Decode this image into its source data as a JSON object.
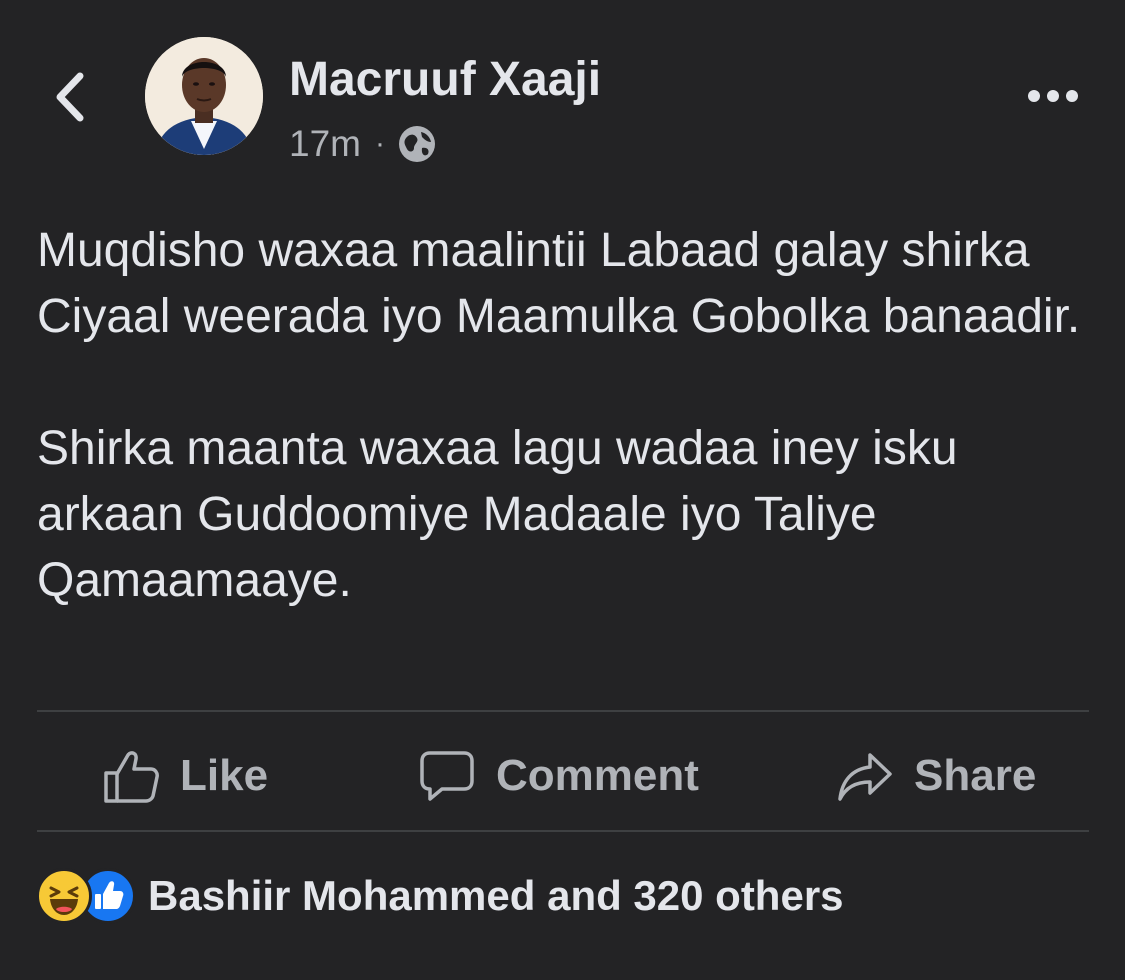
{
  "post": {
    "author": "Macruuf Xaaji",
    "time": "17m",
    "separator": "·",
    "privacy_icon": "globe-icon",
    "paragraphs": [
      "Muqdisho waxaa maalintii Labaad galay shirka Ciyaal weerada iyo Maamulka Gobolka banaadir.",
      "Shirka maanta waxaa lagu wadaa iney isku arkaan Guddoomiye Madaale iyo Taliye Qamaamaaye."
    ]
  },
  "actions": {
    "like_label": "Like",
    "comment_label": "Comment",
    "share_label": "Share"
  },
  "reactions": {
    "icons": [
      "haha-icon",
      "like-icon"
    ],
    "summary": "Bashiir Mohammed and 320 others"
  },
  "colors": {
    "background": "#232325",
    "primary_text": "#e4e6eb",
    "secondary_text": "#b0b3b8",
    "divider": "#3e4042",
    "like_blue": "#1877f2",
    "haha_yellow": "#f7c936"
  }
}
